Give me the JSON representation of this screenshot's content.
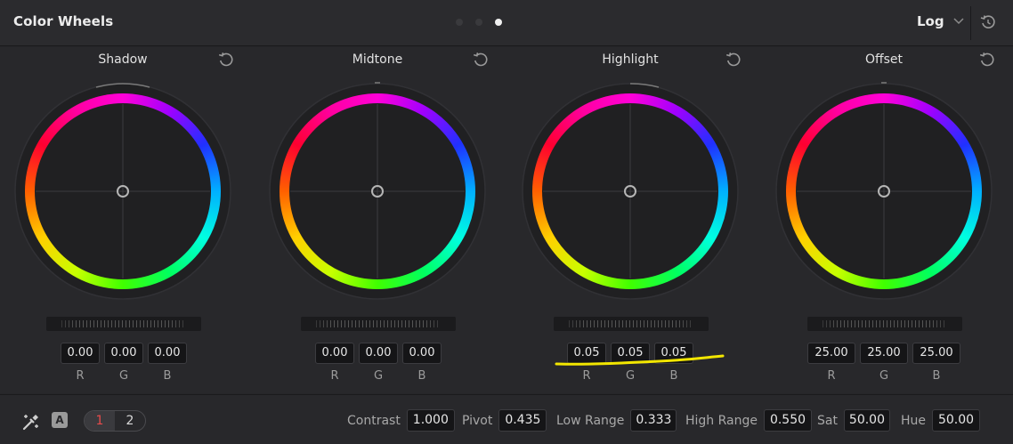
{
  "header": {
    "title": "Color Wheels",
    "page_dots": 3,
    "active_dot": 2,
    "mode_label": "Log"
  },
  "wheels": [
    {
      "title": "Shadow",
      "values": [
        "0.00",
        "0.00",
        "0.00"
      ]
    },
    {
      "title": "Midtone",
      "values": [
        "0.00",
        "0.00",
        "0.00"
      ]
    },
    {
      "title": "Highlight",
      "values": [
        "0.05",
        "0.05",
        "0.05"
      ]
    },
    {
      "title": "Offset",
      "values": [
        "25.00",
        "25.00",
        "25.00"
      ]
    }
  ],
  "channel_labels": [
    "R",
    "G",
    "B"
  ],
  "footer": {
    "auto_label": "A",
    "pages": [
      "1",
      "2"
    ],
    "active_page": "1",
    "contrast": {
      "label": "Contrast",
      "value": "1.000"
    },
    "pivot": {
      "label": "Pivot",
      "value": "0.435"
    },
    "low_range": {
      "label": "Low Range",
      "value": "0.333"
    },
    "high_range": {
      "label": "High Range",
      "value": "0.550"
    },
    "sat": {
      "label": "Sat",
      "value": "50.00"
    },
    "hue": {
      "label": "Hue",
      "value": "50.00"
    }
  },
  "colors": {
    "active_page_text": "#e84b4b",
    "annotation_underline": "#f2e600"
  },
  "icons": [
    "reset-icon",
    "chevron-down-icon",
    "color-picker-icon",
    "auto-balance-icon"
  ]
}
